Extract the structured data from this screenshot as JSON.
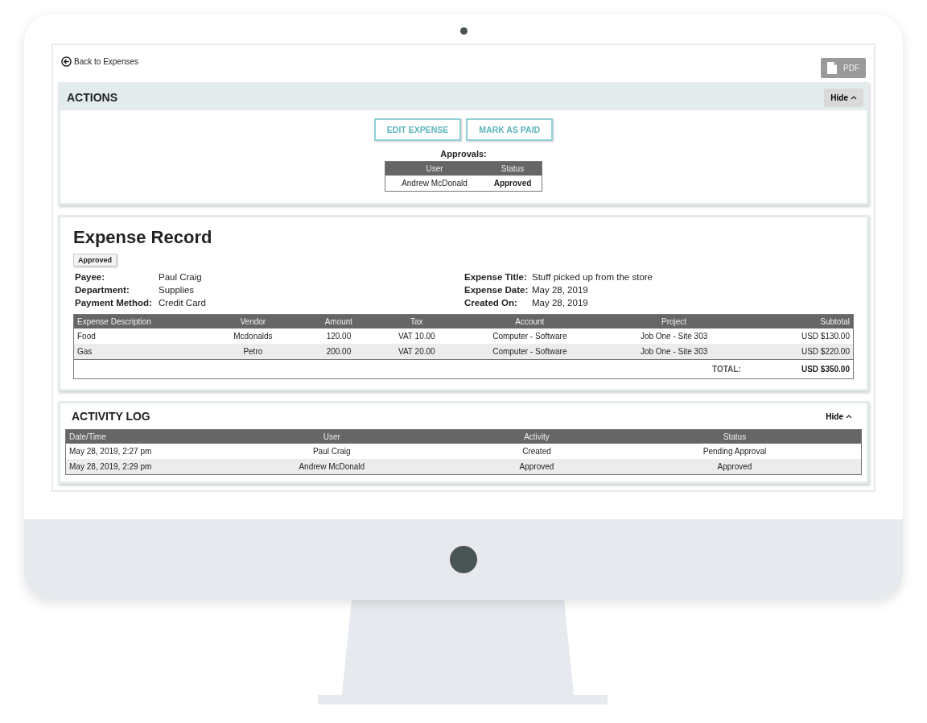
{
  "back_link": "Back to Expenses",
  "pdf_button": "PDF",
  "actions": {
    "title": "ACTIONS",
    "hide": "Hide",
    "buttons": [
      "EDIT EXPENSE",
      "MARK AS PAID"
    ],
    "approvals_label": "Approvals:",
    "approvals": {
      "columns": [
        "User",
        "Status"
      ],
      "rows": [
        [
          "Andrew McDonald",
          "Approved"
        ]
      ]
    }
  },
  "record": {
    "title": "Expense Record",
    "status": "Approved",
    "fields_left": [
      {
        "label": "Payee:",
        "value": "Paul Craig"
      },
      {
        "label": "Department:",
        "value": "Supplies"
      },
      {
        "label": "Payment Method:",
        "value": "Credit Card"
      }
    ],
    "fields_right": [
      {
        "label": "Expense Title:",
        "value": "Stuff picked up from the store"
      },
      {
        "label": "Expense Date:",
        "value": "May 28, 2019"
      },
      {
        "label": "Created On:",
        "value": "May 28, 2019"
      }
    ],
    "table": {
      "columns": [
        "Expense Description",
        "Vendor",
        "Amount",
        "Tax",
        "Account",
        "Project",
        "Subtotal"
      ],
      "rows": [
        [
          "Food",
          "Mcdonalds",
          "120.00",
          "VAT 10.00",
          "Computer - Software",
          "Job One - Site 303",
          "USD $130.00"
        ],
        [
          "Gas",
          "Petro",
          "200.00",
          "VAT 20.00",
          "Computer - Software",
          "Job One - Site 303",
          "USD $220.00"
        ]
      ],
      "total_label": "TOTAL:",
      "total": "USD $350.00"
    }
  },
  "activity_log": {
    "title": "ACTIVITY LOG",
    "hide": "Hide",
    "columns": [
      "Date/Time",
      "User",
      "Activity",
      "Status"
    ],
    "rows": [
      [
        "May 28, 2019, 2:27 pm",
        "Paul Craig",
        "Created",
        "Pending Approval"
      ],
      [
        "May 28, 2019, 2:29 pm",
        "Andrew McDonald",
        "Approved",
        "Approved"
      ]
    ]
  }
}
